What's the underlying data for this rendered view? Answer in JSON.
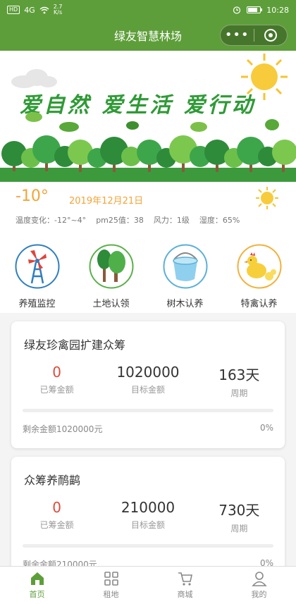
{
  "status_bar": {
    "network": "HD",
    "signal": "4G",
    "speed": "2.7",
    "speed_unit": "K/s",
    "time": "10:28"
  },
  "nav": {
    "title": "绿友智慧林场",
    "more_glyph": "•••"
  },
  "banner": {
    "slogan": "爱自然 爱生活 爱行动"
  },
  "weather": {
    "temperature": "-10°",
    "date": "2019年12月21日",
    "range_label": "温度变化：",
    "range": "-12°~4°",
    "pm_label": "pm25值：",
    "pm": "38",
    "wind_label": "风力：",
    "wind": "1级",
    "humidity_label": "湿度：",
    "humidity": "65%"
  },
  "categories": [
    {
      "label": "养殖监控",
      "icon": "windmill-tower-icon"
    },
    {
      "label": "土地认领",
      "icon": "trees-icon"
    },
    {
      "label": "树木认养",
      "icon": "bucket-icon"
    },
    {
      "label": "特禽认养",
      "icon": "chicken-icon"
    }
  ],
  "projects": [
    {
      "title": "绿友珍禽园扩建众筹",
      "raised": "0",
      "raised_label": "已筹金额",
      "target": "1020000",
      "target_label": "目标金额",
      "period": "163天",
      "period_label": "周期",
      "remaining": "剩余金额1020000元",
      "percent": "0%",
      "progress": 0
    },
    {
      "title": "众筹养鸸鹋",
      "raised": "0",
      "raised_label": "已筹金额",
      "target": "210000",
      "target_label": "目标金额",
      "period": "730天",
      "period_label": "周期",
      "remaining": "剩余金额210000元",
      "percent": "0%",
      "progress": 0
    }
  ],
  "tabs": [
    {
      "label": "首页",
      "icon": "home-icon",
      "active": true
    },
    {
      "label": "租地",
      "icon": "grid-icon",
      "active": false
    },
    {
      "label": "商城",
      "icon": "cart-icon",
      "active": false
    },
    {
      "label": "我的",
      "icon": "person-icon",
      "active": false
    }
  ],
  "colors": {
    "brand": "#5e9e3a",
    "accent_orange": "#f3a437",
    "raised_red": "#e04a3a",
    "slogan_green": "#2f9a36"
  }
}
